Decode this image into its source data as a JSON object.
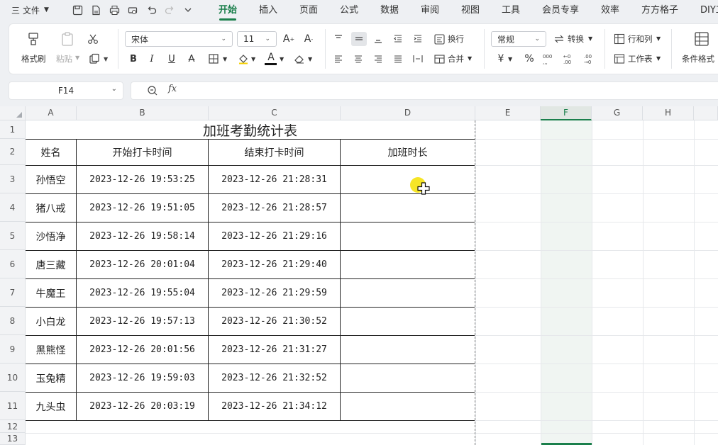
{
  "menu": {
    "hamburger": "三",
    "file": "文件",
    "tabs": [
      "开始",
      "插入",
      "页面",
      "公式",
      "数据",
      "审阅",
      "视图",
      "工具",
      "会员专享",
      "效率",
      "方方格子",
      "DIY工"
    ]
  },
  "ribbon": {
    "format_painter": "格式刷",
    "paste": "粘贴",
    "font_name": "宋体",
    "font_size": "11",
    "wrap": "换行",
    "merge": "合并",
    "number_format": "常规",
    "convert": "转换",
    "rows_cols": "行和列",
    "worksheet": "工作表",
    "conditional_format": "条件格式",
    "currency_symbol": "¥",
    "percent_symbol": "%"
  },
  "formula_bar": {
    "cell_ref": "F14",
    "fx": "fx",
    "value": ""
  },
  "sheet": {
    "columns": [
      "A",
      "B",
      "C",
      "D",
      "E",
      "F",
      "G",
      "H"
    ],
    "selected_column": "F",
    "rows": [
      "1",
      "2",
      "3",
      "4",
      "5",
      "6",
      "7",
      "8",
      "9",
      "10",
      "11",
      "12",
      "13"
    ],
    "title": "加班考勤统计表",
    "headers": [
      "姓名",
      "开始打卡时间",
      "结束打卡时间",
      "加班时长"
    ],
    "data": [
      [
        "孙悟空",
        "2023-12-26 19:53:25",
        "2023-12-26 21:28:31",
        ""
      ],
      [
        "猪八戒",
        "2023-12-26 19:51:05",
        "2023-12-26 21:28:57",
        ""
      ],
      [
        "沙悟净",
        "2023-12-26 19:58:14",
        "2023-12-26 21:29:16",
        ""
      ],
      [
        "唐三藏",
        "2023-12-26 20:01:04",
        "2023-12-26 21:29:40",
        ""
      ],
      [
        "牛魔王",
        "2023-12-26 19:55:04",
        "2023-12-26 21:29:59",
        ""
      ],
      [
        "小白龙",
        "2023-12-26 19:57:13",
        "2023-12-26 21:30:52",
        ""
      ],
      [
        "黑熊怪",
        "2023-12-26 20:01:56",
        "2023-12-26 21:31:27",
        ""
      ],
      [
        "玉兔精",
        "2023-12-26 19:59:03",
        "2023-12-26 21:32:52",
        ""
      ],
      [
        "九头虫",
        "2023-12-26 20:03:19",
        "2023-12-26 21:34:12",
        ""
      ]
    ]
  },
  "colors": {
    "accent": "#1a7f4b",
    "cursor_highlight": "#f5e000"
  }
}
